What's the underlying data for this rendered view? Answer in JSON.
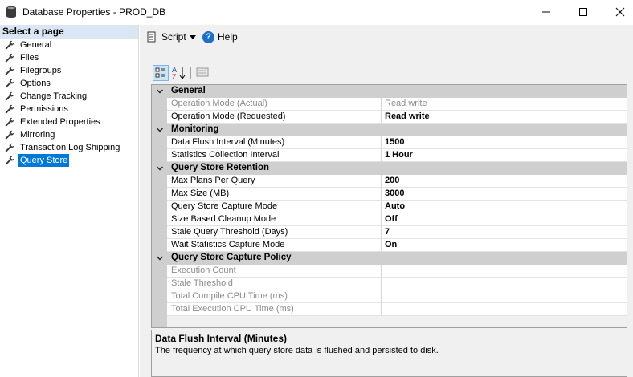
{
  "window": {
    "title": "Database Properties - PROD_DB",
    "icon": "database-icon",
    "buttons": [
      "minimize-icon",
      "maximize-icon",
      "close-icon"
    ]
  },
  "sidebar": {
    "header": "Select a page",
    "items": [
      {
        "label": "General",
        "icon": "wrench-icon"
      },
      {
        "label": "Files",
        "icon": "wrench-icon"
      },
      {
        "label": "Filegroups",
        "icon": "wrench-icon"
      },
      {
        "label": "Options",
        "icon": "wrench-icon"
      },
      {
        "label": "Change Tracking",
        "icon": "wrench-icon"
      },
      {
        "label": "Permissions",
        "icon": "wrench-icon"
      },
      {
        "label": "Extended Properties",
        "icon": "wrench-icon"
      },
      {
        "label": "Mirroring",
        "icon": "wrench-icon"
      },
      {
        "label": "Transaction Log Shipping",
        "icon": "wrench-icon"
      },
      {
        "label": "Query Store",
        "icon": "wrench-icon",
        "selected": true
      }
    ]
  },
  "toolbar": {
    "script_label": "Script",
    "help_label": "Help",
    "help_glyph": "?"
  },
  "propgrid_toolbar": {
    "buttons": [
      "categorized-icon",
      "alphabetical-icon",
      "property-pages-icon"
    ],
    "alpha_glyph": "A",
    "alpha_glyph2": "Z"
  },
  "grid": {
    "categories": [
      {
        "label": "General",
        "rows": [
          {
            "name": "Operation Mode (Actual)",
            "value": "Read write",
            "disabled": true
          },
          {
            "name": "Operation Mode (Requested)",
            "value": "Read write"
          }
        ]
      },
      {
        "label": "Monitoring",
        "rows": [
          {
            "name": "Data Flush Interval (Minutes)",
            "value": "1500"
          },
          {
            "name": "Statistics Collection Interval",
            "value": "1 Hour"
          }
        ]
      },
      {
        "label": "Query Store Retention",
        "rows": [
          {
            "name": "Max Plans Per Query",
            "value": "200"
          },
          {
            "name": "Max Size (MB)",
            "value": "3000"
          },
          {
            "name": "Query Store Capture Mode",
            "value": "Auto"
          },
          {
            "name": "Size Based Cleanup Mode",
            "value": "Off"
          },
          {
            "name": "Stale Query Threshold (Days)",
            "value": "7"
          },
          {
            "name": "Wait Statistics Capture Mode",
            "value": "On"
          }
        ]
      },
      {
        "label": "Query Store Capture Policy",
        "rows": [
          {
            "name": "Execution Count",
            "value": "",
            "disabled": true
          },
          {
            "name": "Stale Threshold",
            "value": "",
            "disabled": true
          },
          {
            "name": "Total Compile CPU Time (ms)",
            "value": "",
            "disabled": true
          },
          {
            "name": "Total Execution CPU Time (ms)",
            "value": "",
            "disabled": true
          }
        ]
      }
    ]
  },
  "description": {
    "title": "Data Flush Interval (Minutes)",
    "text": "The frequency at which query store data is flushed and persisted to disk."
  }
}
